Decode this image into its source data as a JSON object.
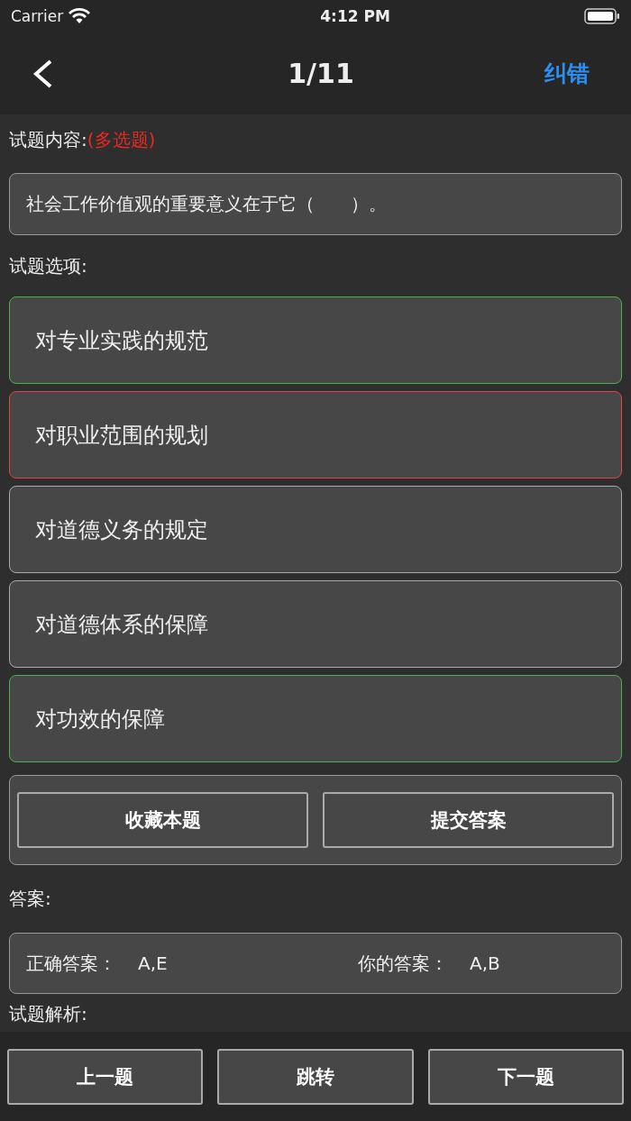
{
  "status_bar": {
    "carrier": "Carrier",
    "time": "4:12 PM"
  },
  "nav": {
    "title": "1/11",
    "action": "纠错"
  },
  "question": {
    "label": "试题内容:",
    "type": "(多选题)",
    "text": "社会工作价值观的重要意义在于它（　　）。"
  },
  "options_label": "试题选项:",
  "options": [
    {
      "text": "对专业实践的规范",
      "color": "#4caf50"
    },
    {
      "text": "对职业范围的规划",
      "color": "#e0463e"
    },
    {
      "text": "对道德义务的规定",
      "color": "#aaaaaa"
    },
    {
      "text": "对道德体系的保障",
      "color": "#aaaaaa"
    },
    {
      "text": "对功效的保障",
      "color": "#4caf50"
    }
  ],
  "actions": [
    "收藏本题",
    "提交答案"
  ],
  "answer": {
    "label": "答案:",
    "correct_label": "正确答案：",
    "correct": "A,E",
    "yours_label": "你的答案：",
    "yours": "A,B"
  },
  "analysis_label": "试题解析:",
  "footer": [
    "上一题",
    "跳转",
    "下一题"
  ]
}
